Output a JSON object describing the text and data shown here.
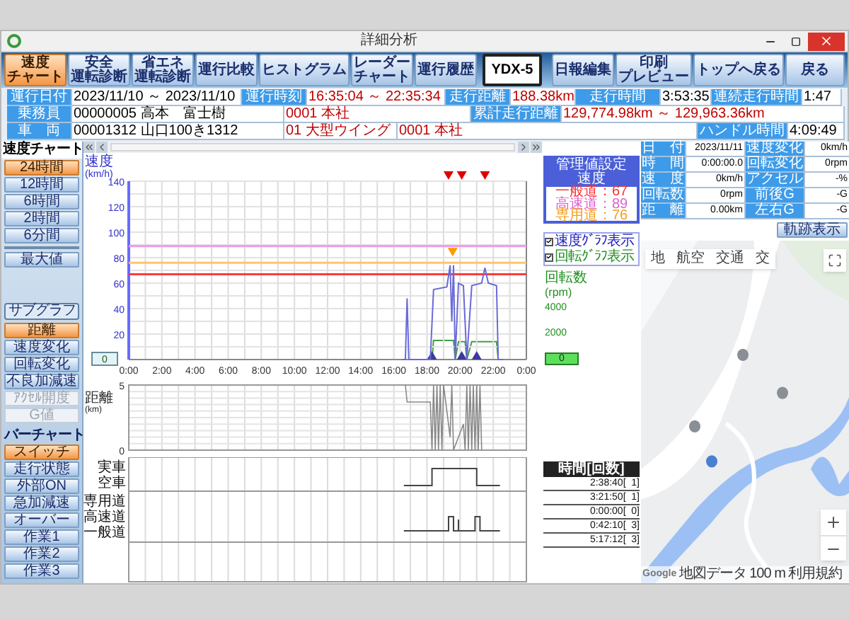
{
  "window": {
    "title": "詳細分析"
  },
  "toolbar": {
    "left": [
      {
        "lines": [
          "速度",
          "チャート"
        ],
        "selected": true,
        "kind": "tab"
      },
      {
        "lines": [
          "安全",
          "運転診断"
        ],
        "selected": false,
        "kind": "tab"
      },
      {
        "lines": [
          "省エネ",
          "運転診断"
        ],
        "selected": false,
        "kind": "tab"
      },
      {
        "lines": [
          "運行比較"
        ],
        "selected": false,
        "kind": "tab"
      },
      {
        "lines": [
          "ヒストグラム"
        ],
        "selected": false,
        "kind": "tab"
      },
      {
        "lines": [
          "レーダー",
          "チャート"
        ],
        "selected": false,
        "kind": "tab"
      },
      {
        "lines": [
          "運行履歴"
        ],
        "selected": false,
        "kind": "tab"
      },
      {
        "lines": [
          "YDX-5"
        ],
        "selected": false,
        "kind": "framed"
      }
    ],
    "right": [
      [
        "日報編集"
      ],
      [
        "印刷",
        "プレビュー"
      ],
      [
        "トップへ戻る"
      ],
      [
        "戻る"
      ]
    ]
  },
  "summary": [
    [
      {
        "text": "運行日付",
        "kind": "label"
      },
      {
        "text": "2023/11/10 ～ 2023/11/10",
        "kind": "value"
      },
      {
        "text": "運行時刻",
        "kind": "label"
      },
      {
        "text": "16:35:04 ～ 22:35:34",
        "kind": "highlight"
      },
      {
        "text": "走行距離",
        "kind": "label"
      },
      {
        "text": "188.38km",
        "kind": "highlight"
      },
      {
        "text": "走行時間",
        "kind": "label"
      },
      {
        "text": "3:53:35",
        "kind": "value"
      },
      {
        "text": "連続走行時間",
        "kind": "label"
      },
      {
        "text": "1:47",
        "kind": "value"
      }
    ],
    [
      {
        "text": "乗務員",
        "kind": "label"
      },
      {
        "text": "00000005 高本　富士樹",
        "kind": "value"
      },
      {
        "text": "0001 本社",
        "kind": "highlight"
      },
      {
        "text": "累計走行距離",
        "kind": "label"
      },
      {
        "text": "129,774.98km ～ 129,963.36km",
        "kind": "highlight"
      }
    ],
    [
      {
        "text": "車　両",
        "kind": "label"
      },
      {
        "text": "00001312 山口100き1312",
        "kind": "value"
      },
      {
        "text": "01 大型ウイング",
        "kind": "highlight"
      },
      {
        "text": "0001 本社",
        "kind": "highlight"
      },
      {
        "text": "ハンドル時間",
        "kind": "label"
      },
      {
        "text": "4:09:49",
        "kind": "value"
      }
    ]
  ],
  "left_panel": {
    "header": "速度チャート",
    "ranges": [
      {
        "label": "24時間",
        "selected": true
      },
      {
        "label": "12時間",
        "selected": false
      },
      {
        "label": "6時間",
        "selected": false
      },
      {
        "label": "2時間",
        "selected": false
      },
      {
        "label": "6分間",
        "selected": false
      }
    ],
    "max_button": "最大値",
    "subgraph_button": "サブグラフ",
    "subgraphs": [
      {
        "label": "距離",
        "selected": true,
        "disabled": false
      },
      {
        "label": "速度変化",
        "selected": false,
        "disabled": false
      },
      {
        "label": "回転変化",
        "selected": false,
        "disabled": false
      },
      {
        "label": "不良加減速",
        "selected": false,
        "disabled": false
      },
      {
        "label": "ｱｸｾﾙ開度",
        "selected": false,
        "disabled": true
      },
      {
        "label": "G値",
        "selected": false,
        "disabled": true
      }
    ],
    "bar_header": "バーチャート",
    "bars": [
      {
        "label": "スイッチ",
        "selected": true
      },
      {
        "label": "走行状態",
        "selected": false
      },
      {
        "label": "外部ON",
        "selected": false
      },
      {
        "label": "急加減速",
        "selected": false
      },
      {
        "label": "オーバー",
        "selected": false
      },
      {
        "label": "作業1",
        "selected": false
      },
      {
        "label": "作業2",
        "selected": false
      },
      {
        "label": "作業3",
        "selected": false
      }
    ]
  },
  "speed_chart": {
    "left_value": "0",
    "chart_data": {
      "type": "line",
      "ylabel": "速度\n(km/h)",
      "grid": true,
      "xlim": [
        0,
        24
      ],
      "ylim": [
        0,
        140
      ],
      "yticks": [
        20,
        40,
        60,
        80,
        100,
        120,
        140
      ],
      "xticks": [
        {
          "value": 0,
          "label": "0:00"
        },
        {
          "value": 2,
          "label": "2:00"
        },
        {
          "value": 4,
          "label": "4:00"
        },
        {
          "value": 6,
          "label": "6:00"
        },
        {
          "value": 8,
          "label": "8:00"
        },
        {
          "value": 10,
          "label": "10:00"
        },
        {
          "value": 12,
          "label": "12:00"
        },
        {
          "value": 14,
          "label": "14:00"
        },
        {
          "value": 16,
          "label": "16:00"
        },
        {
          "value": 18,
          "label": "18:00"
        },
        {
          "value": 20,
          "label": "20:00"
        },
        {
          "value": 22,
          "label": "22:00"
        },
        {
          "value": 24,
          "label": "0:00"
        }
      ],
      "x": [
        16.5,
        16.7,
        16.8,
        16.9,
        18.2,
        18.4,
        19.2,
        19.4,
        19.5,
        19.6,
        19.7,
        19.9,
        20.2,
        20.4,
        20.7,
        21.3,
        21.5,
        21.7,
        22.2,
        22.3,
        22.6
      ],
      "series": [
        {
          "color": "#6a6ad8",
          "values": [
            0,
            0,
            48,
            0,
            0,
            55,
            57,
            74,
            30,
            74,
            0,
            60,
            58,
            0,
            58,
            60,
            72,
            60,
            58,
            0,
            0
          ]
        }
      ],
      "ref_lines": [
        {
          "axis": "y",
          "value": 89,
          "color": "#f09ae6"
        },
        {
          "axis": "y",
          "value": 76,
          "color": "#ffc46a"
        },
        {
          "axis": "y",
          "value": 67,
          "color": "#ff3a3a"
        }
      ]
    }
  },
  "distance_chart": {
    "chart_data": {
      "type": "line",
      "ylabel": "距離\n(km)",
      "grid": true,
      "xlim": [
        0,
        24
      ],
      "ylim": [
        0,
        5
      ],
      "yticks": [
        0,
        5
      ],
      "x": [
        16.7,
        16.8,
        18.2,
        18.3,
        18.4,
        18.5,
        18.6,
        18.7,
        18.8,
        18.9,
        19.0,
        19.4,
        19.5,
        19.6,
        20.2,
        20.3,
        20.4,
        20.5,
        20.6,
        20.7,
        20.8,
        20.9,
        21.0,
        21.1,
        21.2,
        21.3
      ],
      "series": [
        {
          "color": "#888888",
          "values": [
            5,
            3.7,
            3.7,
            0,
            5,
            0,
            5,
            0,
            5,
            0,
            5,
            1,
            5,
            0,
            2,
            0,
            5,
            0,
            5,
            0,
            5,
            0,
            5,
            0,
            5,
            0
          ]
        }
      ]
    }
  },
  "bar_chart": {
    "groups": [
      [
        "実車",
        "空車"
      ],
      [
        "専用道",
        "高速道",
        "一般道"
      ]
    ]
  },
  "management": {
    "title": "管理値設定",
    "subtitle": "速度",
    "items": [
      {
        "label": "一般道：67",
        "color": "#ff3030"
      },
      {
        "label": "高速道：89",
        "color": "#e060d0"
      },
      {
        "label": "専用道：76",
        "color": "#f0a020"
      }
    ]
  },
  "graph_toggles": [
    {
      "label": "速度ｸﾞﾗﾌ表示",
      "checked": true,
      "color": "#2020c0"
    },
    {
      "label": "回転ｸﾞﾗﾌ表示",
      "checked": true,
      "color": "#209020"
    }
  ],
  "rpm_axis": {
    "label": "回転数",
    "unit": "(rpm)",
    "ticks": [
      "4000",
      "2000"
    ],
    "value": "0"
  },
  "time_table": {
    "header": "時間[回数]",
    "rows": [
      "2:38:40[  1]",
      "3:21:50[  1]",
      "0:00:00[  0]",
      "0:42:10[  3]",
      "5:17:12[  3]"
    ]
  },
  "detail": [
    [
      "日　付",
      "2023/11/11",
      "速度変化",
      "0km/h"
    ],
    [
      "時　間",
      "0:00:00.0",
      "回転変化",
      "0rpm"
    ],
    [
      "速　度",
      "0km/h",
      "アクセル",
      "-%"
    ],
    [
      "回転数",
      "0rpm",
      "前後G",
      "-G"
    ],
    [
      "距　離",
      "0.00km",
      "左右G",
      "-G"
    ]
  ],
  "track_button": "軌跡表示",
  "map": {
    "kind": "picture",
    "type_buttons": [
      "地",
      "航空",
      "交通",
      "交"
    ],
    "attribution": [
      "Google",
      "地図データ",
      "100 m",
      "利用規約"
    ]
  }
}
